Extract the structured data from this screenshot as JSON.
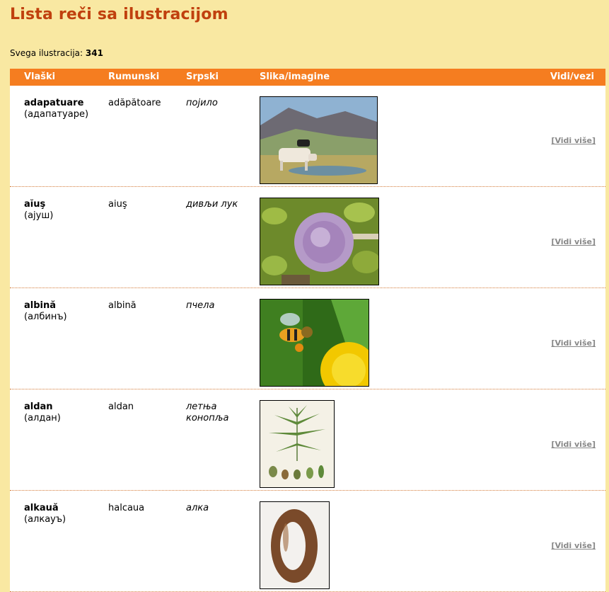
{
  "page": {
    "title": "Lista reči sa ilustracijom",
    "total_label": "Svega ilustracija:",
    "total_value": "341"
  },
  "table": {
    "headers": [
      "Vlaški",
      "Rumunski",
      "Srpski",
      "Slika/imagine",
      "Vidi/vezi"
    ],
    "rows": [
      {
        "vlaski": "adapatuare",
        "cyr": "(адапатуаре)",
        "rumunski": "adăpătoare",
        "srpski": "појило",
        "image": "cow-grazing-mountain-image",
        "more": "[Vidi više]"
      },
      {
        "vlaski": "aĭuş",
        "cyr": "(ајуш)",
        "rumunski": "aiuş",
        "srpski": "дивљи лук",
        "image": "wild-onion-flower-image",
        "more": "[Vidi više]"
      },
      {
        "vlaski": "albină",
        "cyr": "(албинъ)",
        "rumunski": "albină",
        "srpski": "пчела",
        "image": "bee-on-dandelion-image",
        "more": "[Vidi više]"
      },
      {
        "vlaski": "aldan",
        "cyr": "(алдан)",
        "rumunski": "aldan",
        "srpski": "летња конопља",
        "image": "hemp-botanical-illustration-image",
        "more": "[Vidi više]"
      },
      {
        "vlaski": "alkauă",
        "cyr": "(алкауъ)",
        "rumunski": "halcaua",
        "srpski": "алка",
        "image": "wooden-ring-image",
        "more": "[Vidi više]"
      }
    ]
  }
}
